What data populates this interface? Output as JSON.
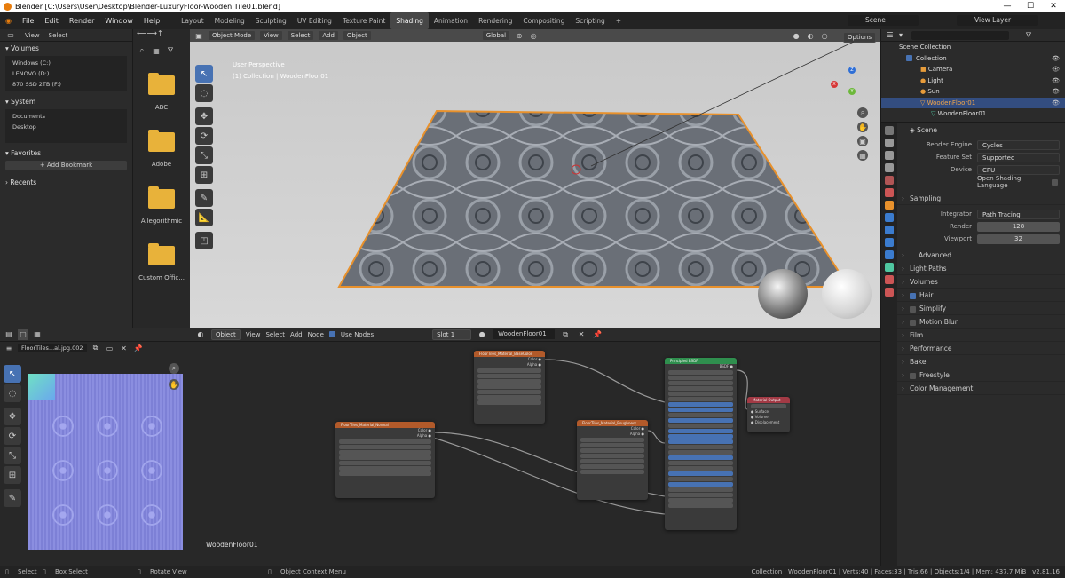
{
  "window": {
    "title": "Blender [C:\\Users\\User\\Desktop\\Blender-LuxuryFloor-Wooden Tile01.blend]"
  },
  "menu": [
    "File",
    "Edit",
    "Render",
    "Window",
    "Help"
  ],
  "workspaces": [
    "Layout",
    "Modeling",
    "Sculpting",
    "UV Editing",
    "Texture Paint",
    "Shading",
    "Animation",
    "Rendering",
    "Compositing",
    "Scripting",
    "+"
  ],
  "topright": {
    "scene": "Scene",
    "view_layer": "View Layer"
  },
  "filebrowser": {
    "header": {
      "view": "View",
      "select": "Select"
    },
    "volumes_title": "Volumes",
    "volumes": [
      "Windows (C:)",
      "LENOVO (D:)",
      "870 SSD 2TB (F:)"
    ],
    "system_title": "System",
    "system": [
      "Documents",
      "Desktop"
    ],
    "favorites_title": "Favorites",
    "add_bookmark": "Add Bookmark",
    "recents_title": "Recents",
    "folders": [
      "ABC",
      "Adobe",
      "Allegorithmic",
      "Custom Offic..."
    ]
  },
  "viewport": {
    "mode": "Object Mode",
    "menus": [
      "View",
      "Select",
      "Add",
      "Object"
    ],
    "transform": "Global",
    "options": "Options",
    "overlay_line1": "User Perspective",
    "overlay_line2": "(1) Collection | WoodenFloor01",
    "axes": {
      "x": "X",
      "y": "Y",
      "z": "Z"
    }
  },
  "image_editor": {
    "image_name": "FloorTiles...al.jpg.002"
  },
  "node_editor": {
    "object": "Object",
    "menus": [
      "View",
      "Select",
      "Add",
      "Node"
    ],
    "use_nodes": "Use Nodes",
    "slot": "Slot 1",
    "material": "WoodenFloor01",
    "footer_label": "WoodenFloor01",
    "nodes": {
      "tex1": "FloorTiles_Material_BaseColor",
      "tex2": "FloorTiles_Material_Normal",
      "tex3": "FloorTiles_Material_Roughness",
      "bsdf": "Principled BSDF",
      "out": "Material Output"
    }
  },
  "outliner": {
    "root": "Scene Collection",
    "items": [
      {
        "name": "Collection",
        "depth": 1
      },
      {
        "name": "Camera",
        "depth": 2
      },
      {
        "name": "Light",
        "depth": 2
      },
      {
        "name": "Sun",
        "depth": 2
      },
      {
        "name": "WoodenFloor01",
        "depth": 2
      },
      {
        "name": "WoodenFloor01",
        "depth": 3
      }
    ]
  },
  "properties": {
    "scene": "Scene",
    "render_engine_label": "Render Engine",
    "render_engine": "Cycles",
    "feature_set_label": "Feature Set",
    "feature_set": "Supported",
    "device_label": "Device",
    "device": "CPU",
    "osl": "Open Shading Language",
    "sampling": "Sampling",
    "integrator_label": "Integrator",
    "integrator": "Path Tracing",
    "render_label": "Render",
    "render_samples": "128",
    "viewport_label": "Viewport",
    "viewport_samples": "32",
    "advanced": "Advanced",
    "sections": [
      "Light Paths",
      "Volumes",
      "Hair",
      "Simplify",
      "Motion Blur",
      "Film",
      "Performance",
      "Bake",
      "Freestyle",
      "Color Management"
    ]
  },
  "statusbar": {
    "select": "Select",
    "box_select": "Box Select",
    "rotate_view": "Rotate View",
    "context_menu": "Object Context Menu",
    "stats": "Collection | WoodenFloor01 | Verts:40 | Faces:33 | Tris:66 | Objects:1/4 | Mem: 437.7 MiB | v2.81.16"
  },
  "colors": {
    "accent": "#4772b3",
    "selected": "#e8912c",
    "folder": "#e8b23a"
  }
}
